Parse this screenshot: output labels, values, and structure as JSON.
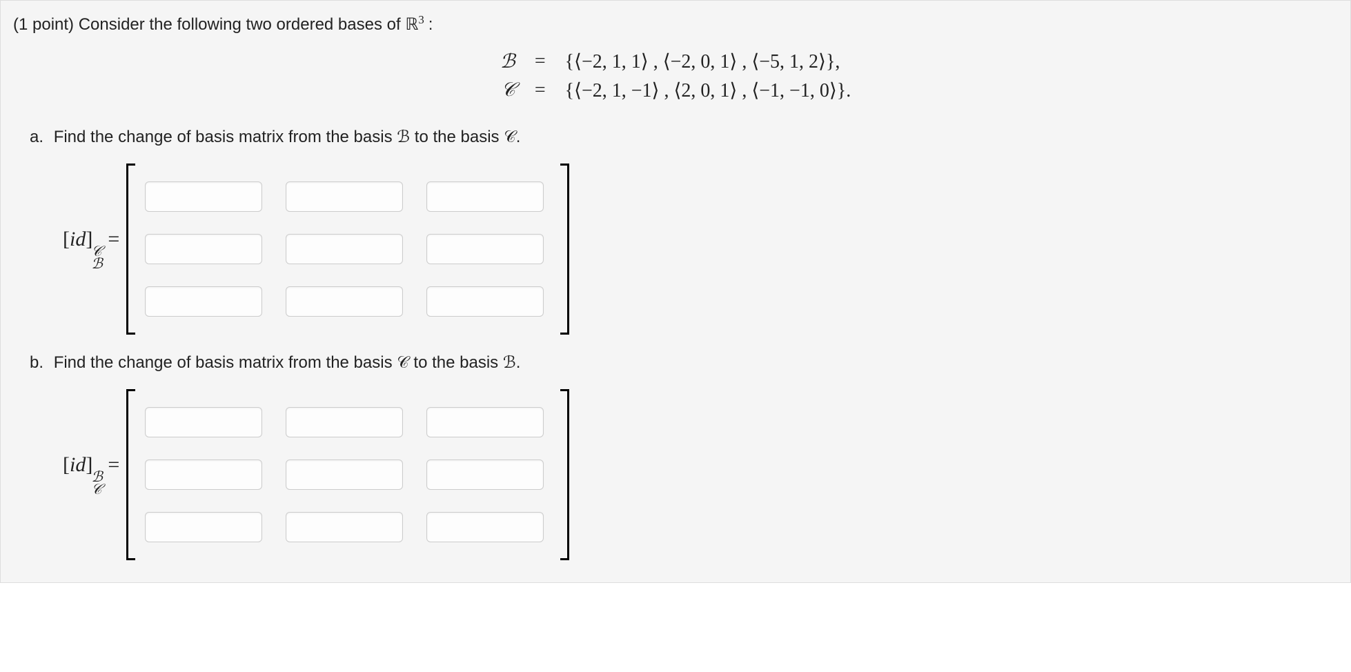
{
  "header": {
    "points": "(1 point)",
    "prompt": "Consider the following two ordered bases of",
    "space": "ℝ",
    "space_exp": "3",
    "colon": ":"
  },
  "bases": {
    "B_label": "ℬ",
    "C_label": "𝒞",
    "eq": "=",
    "B_value": "{⟨−2, 1, 1⟩ , ⟨−2, 0, 1⟩ , ⟨−5, 1, 2⟩},",
    "C_value": "{⟨−2, 1, −1⟩ , ⟨2, 0, 1⟩ , ⟨−1, −1, 0⟩}."
  },
  "part_a": {
    "label": "a.",
    "text_pre": "Find the change of basis matrix from the basis ",
    "B": "ℬ",
    "text_mid": " to the basis ",
    "C": "𝒞",
    "text_post": ".",
    "lhs_id": "[id]",
    "lhs_sup": "𝒞",
    "lhs_sub": "ℬ",
    "equals": " ="
  },
  "part_b": {
    "label": "b.",
    "text_pre": "Find the change of basis matrix from the basis ",
    "C": "𝒞",
    "text_mid": " to the basis ",
    "B": "ℬ",
    "text_post": ".",
    "lhs_id": "[id]",
    "lhs_sup": "ℬ",
    "lhs_sub": "𝒞",
    "equals": " ="
  },
  "matrix_a": {
    "cells": [
      [
        "",
        "",
        ""
      ],
      [
        "",
        "",
        ""
      ],
      [
        "",
        "",
        ""
      ]
    ]
  },
  "matrix_b": {
    "cells": [
      [
        "",
        "",
        ""
      ],
      [
        "",
        "",
        ""
      ],
      [
        "",
        "",
        ""
      ]
    ]
  }
}
